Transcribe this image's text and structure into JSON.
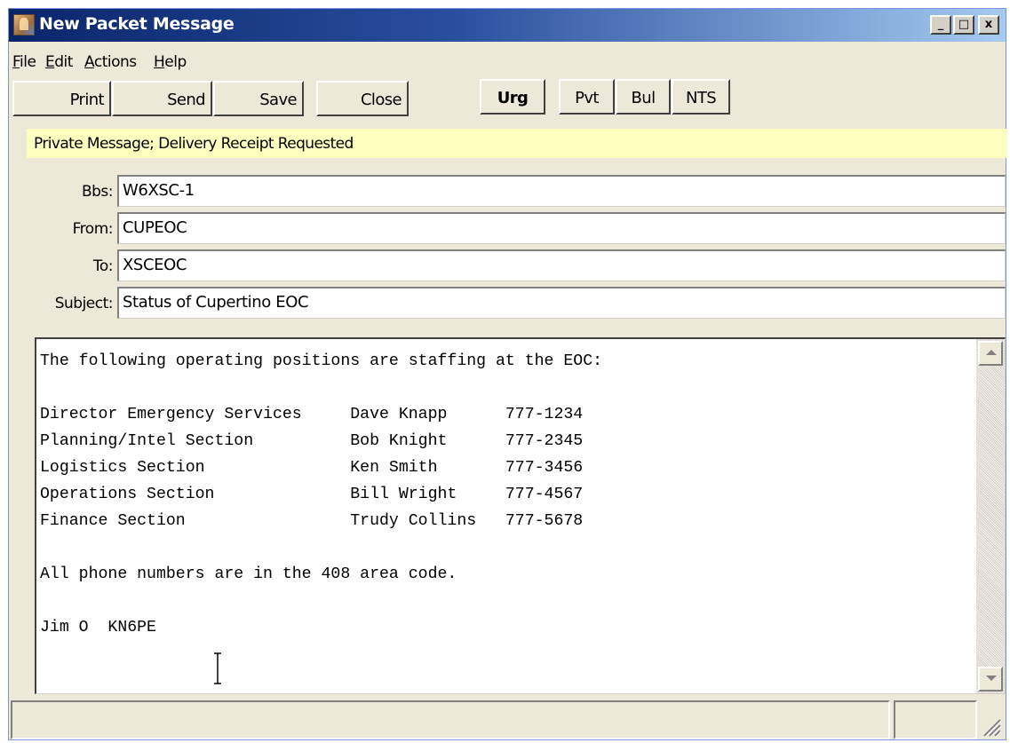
{
  "window": {
    "title": "New Packet Message"
  },
  "title_buttons": {
    "minimize": "_",
    "maximize": "□",
    "close": "x"
  },
  "menu": [
    {
      "label": "File",
      "accel": "F",
      "rest": "ile"
    },
    {
      "label": "Edit",
      "accel": "E",
      "rest": "dit"
    },
    {
      "label": "Actions",
      "accel": "A",
      "rest": "ctions"
    },
    {
      "label": "Help",
      "accel": "H",
      "rest": "elp"
    }
  ],
  "toolbar": {
    "print": "Print",
    "send": "Send",
    "save": "Save",
    "close": "Close",
    "urg": "Urg",
    "pvt": "Pvt",
    "bul": "Bul",
    "nts": "NTS"
  },
  "info": "Private Message;  Delivery Receipt Requested",
  "fields": {
    "bbs": {
      "label": "Bbs:",
      "value": "W6XSC-1"
    },
    "from": {
      "label": "From:",
      "value": "CUPEOC"
    },
    "to": {
      "label": "To:",
      "value": "XSCEOC"
    },
    "subject": {
      "label": "Subject:",
      "value": "Status of Cupertino EOC"
    }
  },
  "message_body": "The following operating positions are staffing at the EOC:\n\nDirector Emergency Services     Dave Knapp      777-1234\nPlanning/Intel Section          Bob Knight      777-2345\nLogistics Section               Ken Smith       777-3456\nOperations Section              Bill Wright     777-4567\nFinance Section                 Trudy Collins   777-5678\n\nAll phone numbers are in the 408 area code.\n\nJim O  KN6PE",
  "colors": {
    "info_bar": "#ffffc0",
    "titlebar_start": "#0a246a",
    "titlebar_end": "#a6caf0",
    "chrome": "#ece9d8"
  },
  "icons": [
    "app-icon",
    "scroll-up-arrow-icon",
    "scroll-down-arrow-icon",
    "text-cursor-icon",
    "size-grip-icon"
  ]
}
